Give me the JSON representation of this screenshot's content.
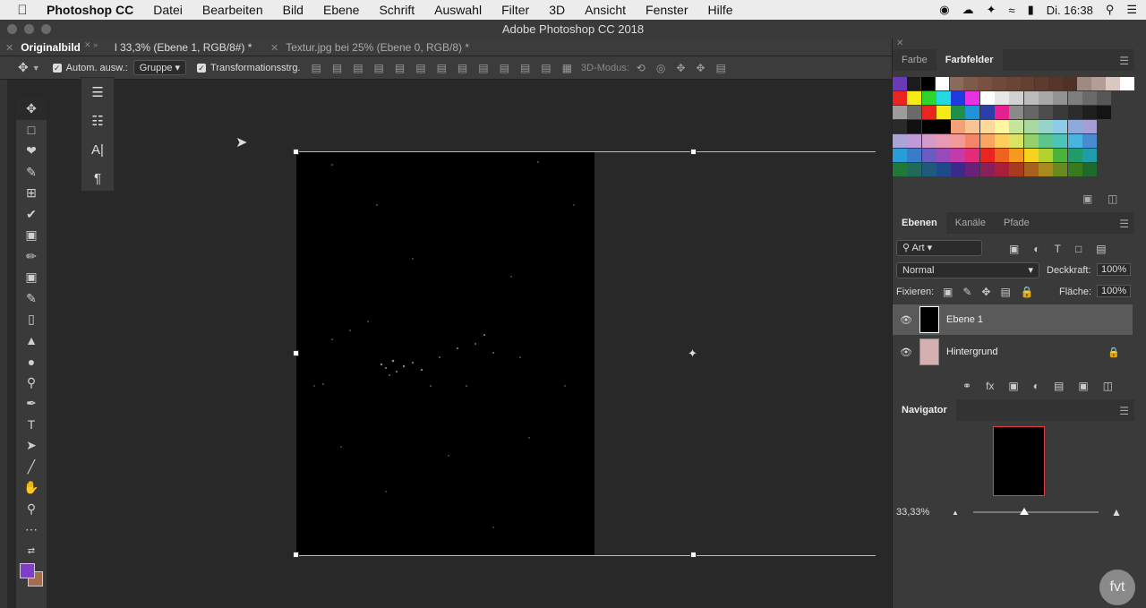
{
  "menubar": {
    "items": [
      "Photoshop CC",
      "Datei",
      "Bearbeiten",
      "Bild",
      "Ebene",
      "Schrift",
      "Auswahl",
      "Filter",
      "3D",
      "Ansicht",
      "Fenster",
      "Hilfe"
    ],
    "clock": "Di. 16:38"
  },
  "window": {
    "title": "Adobe Photoshop CC 2018"
  },
  "doc_tabs": [
    {
      "label": "Originalbild"
    },
    {
      "label": "l 33,3% (Ebene 1, RGB/8#) *"
    },
    {
      "label": "Textur.jpg bei 25% (Ebene 0, RGB/8) *"
    }
  ],
  "options_bar": {
    "auto_select_label": "Autom. ausw.:",
    "auto_select_value": "Gruppe",
    "transform_label": "Transformationsstrg.",
    "mode_3d_label": "3D-Modus:"
  },
  "color_panel": {
    "tabs": [
      "Farbe",
      "Farbfelder"
    ],
    "active_tab": "Farbfelder",
    "swatch_rows": [
      [
        "#6b3bb6",
        "#1c1c1c",
        "#000000",
        "#ffffff",
        "#8a6a5a",
        "#7e5a4a",
        "#7a5040",
        "#6d4a3a",
        "#6a4535",
        "#634032",
        "#5d3b2f",
        "#56362b",
        "#4f3128",
        "#9e8a82",
        "#b69c96",
        "#d8c8c4",
        "#ffffff"
      ],
      [
        "#e8261f",
        "#f7ea1a",
        "#2fd52f",
        "#23d9e2",
        "#1f3be0",
        "#e831e0",
        "#ffffff",
        "#e6e6e6",
        "#d1d1d1",
        "#bcbcbc",
        "#a8a8a8",
        "#939393",
        "#7e7e7e",
        "#6a6a6a",
        "#575757"
      ],
      [
        "#9c9c9c",
        "#6a6a6a",
        "#e8261f",
        "#f7ea1a",
        "#1f8f4a",
        "#1f93d6",
        "#2a3fa8",
        "#e4218f",
        "#8a8a8a",
        "#666666",
        "#4d4d4d",
        "#3a3a3a",
        "#2c2c2c",
        "#1f1f1f",
        "#141414"
      ],
      [
        "#2a2a2a",
        "#111111",
        "#000000",
        "#000000",
        "#f4a07a",
        "#f8c494",
        "#ffd89a",
        "#fff7a0",
        "#c6e49a",
        "#a8d8a0",
        "#96d4c8",
        "#8ecbe8",
        "#8eaadc",
        "#a89cd4"
      ],
      [
        "#a9a3d6",
        "#c09ad4",
        "#d49ac8",
        "#e89ab4",
        "#f09a9a",
        "#f4846a",
        "#f8a662",
        "#fbce5e",
        "#d8e462",
        "#96d06a",
        "#5ec48a",
        "#4ec4b8",
        "#4ab4e0",
        "#4a8ad0"
      ],
      [
        "#2a9cd8",
        "#3a7cc8",
        "#6a5cc0",
        "#9a4ab8",
        "#c43aa8",
        "#e42a7a",
        "#e8261f",
        "#f0621f",
        "#f49a1f",
        "#f7d21f",
        "#b4d22f",
        "#4ab43a",
        "#1f9c6a",
        "#1f9ca8"
      ],
      [
        "#1f7a3a",
        "#1f6a5a",
        "#1f5a7a",
        "#1f4a8a",
        "#3a2a8a",
        "#6a1f7a",
        "#8a1f5a",
        "#a81f3a",
        "#a83a1f",
        "#a8621f",
        "#a88a1f",
        "#6a8a1f",
        "#3a7a1f",
        "#1f6a2a"
      ]
    ]
  },
  "layers_panel": {
    "tabs": [
      "Ebenen",
      "Kanäle",
      "Pfade"
    ],
    "active_tab": "Ebenen",
    "filter_value": "Art",
    "blend_mode": "Normal",
    "opacity_label": "Deckkraft:",
    "opacity_value": "100%",
    "lock_label": "Fixieren:",
    "fill_label": "Fläche:",
    "fill_value": "100%",
    "layers": [
      {
        "name": "Ebene 1",
        "selected": true
      },
      {
        "name": "Hintergrund",
        "selected": false
      }
    ]
  },
  "navigator": {
    "title": "Navigator",
    "zoom": "33,33%"
  },
  "watermark": {
    "text": "fvt"
  },
  "colors": {
    "foreground": "#7e3fc4",
    "background": "#a56d4f"
  }
}
